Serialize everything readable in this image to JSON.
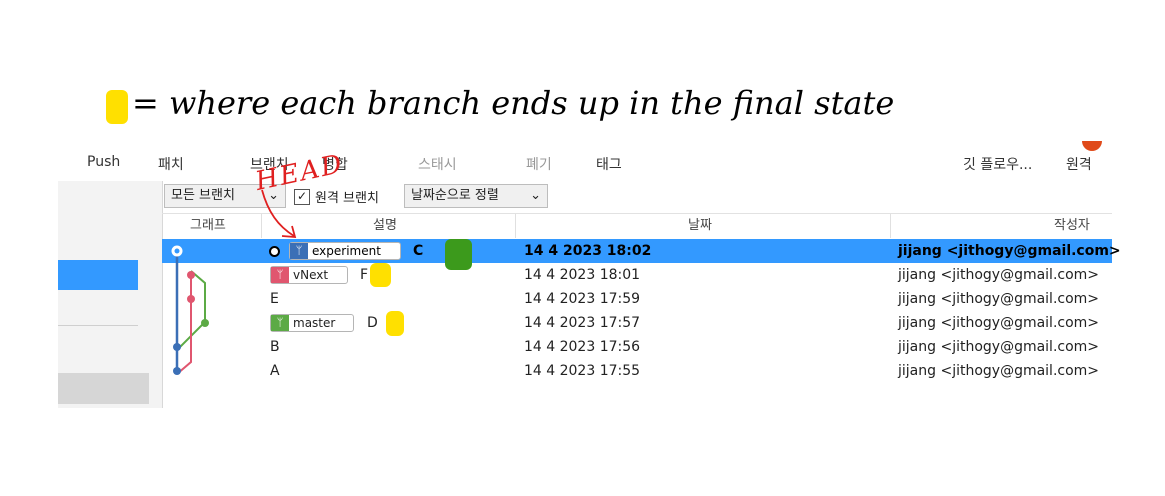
{
  "annotations": {
    "legend_text": "= where each branch ends up in the final state",
    "head_label": "HEAD",
    "marker_color": "#ffe000",
    "head_marker_color": "#3c9a1c",
    "ink_color": "#e02020"
  },
  "toolbar": {
    "items": [
      "Push",
      "패치",
      "브랜치",
      "병합",
      "스태시",
      "폐기",
      "태그"
    ],
    "right_items": [
      "깃 플로우...",
      "원격"
    ]
  },
  "filter_bar": {
    "branch_select": "모든 브랜치",
    "remote_checkbox_label": "원격 브랜치",
    "remote_checked": true,
    "sort_select": "날짜순으로 정렬"
  },
  "columns": [
    "그래프",
    "설명",
    "날짜",
    "작성자"
  ],
  "commits": [
    {
      "branch": "experiment",
      "desc": "C",
      "date": "14 4 2023 18:02",
      "author": "jijang <jithogy@gmail.com>",
      "head": true
    },
    {
      "branch": "vNext",
      "desc": "F",
      "date": "14 4 2023 18:01",
      "author": "jijang <jithogy@gmail.com>"
    },
    {
      "branch": "",
      "desc": "E",
      "date": "14 4 2023 17:59",
      "author": "jijang <jithogy@gmail.com>"
    },
    {
      "branch": "master",
      "desc": "D",
      "date": "14 4 2023 17:57",
      "author": "jijang <jithogy@gmail.com>"
    },
    {
      "branch": "",
      "desc": "B",
      "date": "14 4 2023 17:56",
      "author": "jijang <jithogy@gmail.com>"
    },
    {
      "branch": "",
      "desc": "A",
      "date": "14 4 2023 17:55",
      "author": "jijang <jithogy@gmail.com>"
    }
  ],
  "branch_colors": {
    "experiment": "#3b6fb6",
    "vNext": "#e0566f",
    "master": "#5caa45"
  }
}
